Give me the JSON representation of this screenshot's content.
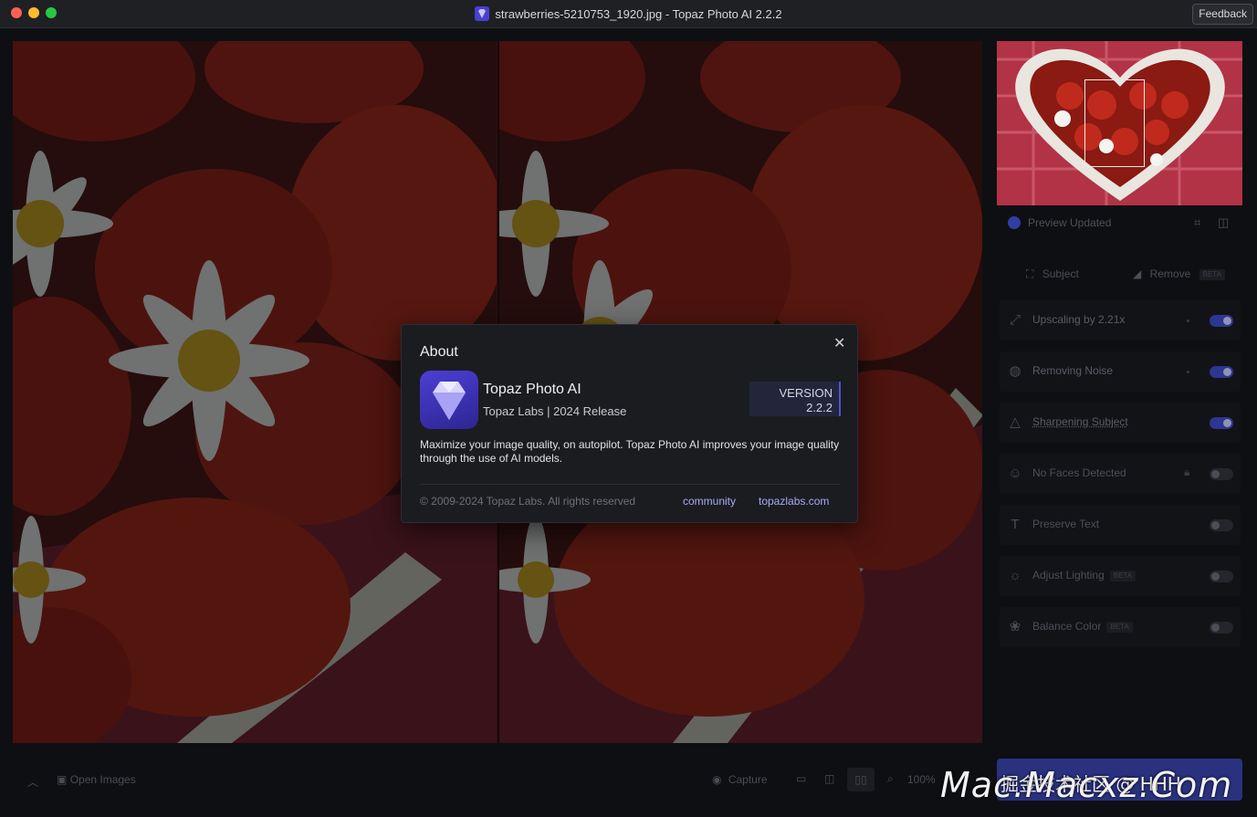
{
  "window": {
    "title": "strawberries-5210753_1920.jpg - Topaz Photo AI 2.2.2",
    "feedback_label": "Feedback"
  },
  "sidebar": {
    "preview_status": "Preview Updated",
    "tools": {
      "subject_label": "Subject",
      "remove_label": "Remove",
      "remove_badge": "BETA"
    },
    "features": [
      {
        "label": "Upscaling by 2.21x",
        "icon": "upscale-icon",
        "enabled": true
      },
      {
        "label": "Removing Noise",
        "icon": "noise-icon",
        "enabled": true
      },
      {
        "label": "Sharpening Subject",
        "icon": "sharpen-icon",
        "enabled": true
      },
      {
        "label": "No Faces Detected",
        "icon": "face-icon",
        "enabled": false,
        "locked": true
      },
      {
        "label": "Preserve Text",
        "icon": "text-icon",
        "enabled": false
      },
      {
        "label": "Adjust Lighting",
        "icon": "sun-icon",
        "enabled": false,
        "badge": "BETA"
      },
      {
        "label": "Balance Color",
        "icon": "palette-icon",
        "enabled": false,
        "badge": "BETA"
      }
    ]
  },
  "bottombar": {
    "open_images_label": "Open Images",
    "capture_label": "Capture",
    "zoom_label": "100%"
  },
  "about": {
    "title": "About",
    "app_name": "Topaz Photo AI",
    "app_subtitle": "Topaz Labs | 2024 Release",
    "version_label": "VERSION",
    "version_number": "2.2.2",
    "description": "Maximize your image quality, on autopilot. Topaz Photo AI improves your image quality through the use of AI models.",
    "copyright": "© 2009-2024 Topaz Labs. All rights reserved",
    "link_community": "community",
    "link_site": "topazlabs.com"
  },
  "watermark": {
    "latin": "Mac.Macxz.Com",
    "cjk": "掘金技术社区 @ HHH"
  },
  "colors": {
    "accent": "#4a55d0",
    "link": "#a6acf2",
    "toggle_on": "#2d3690",
    "export_button": "#2a3280"
  }
}
